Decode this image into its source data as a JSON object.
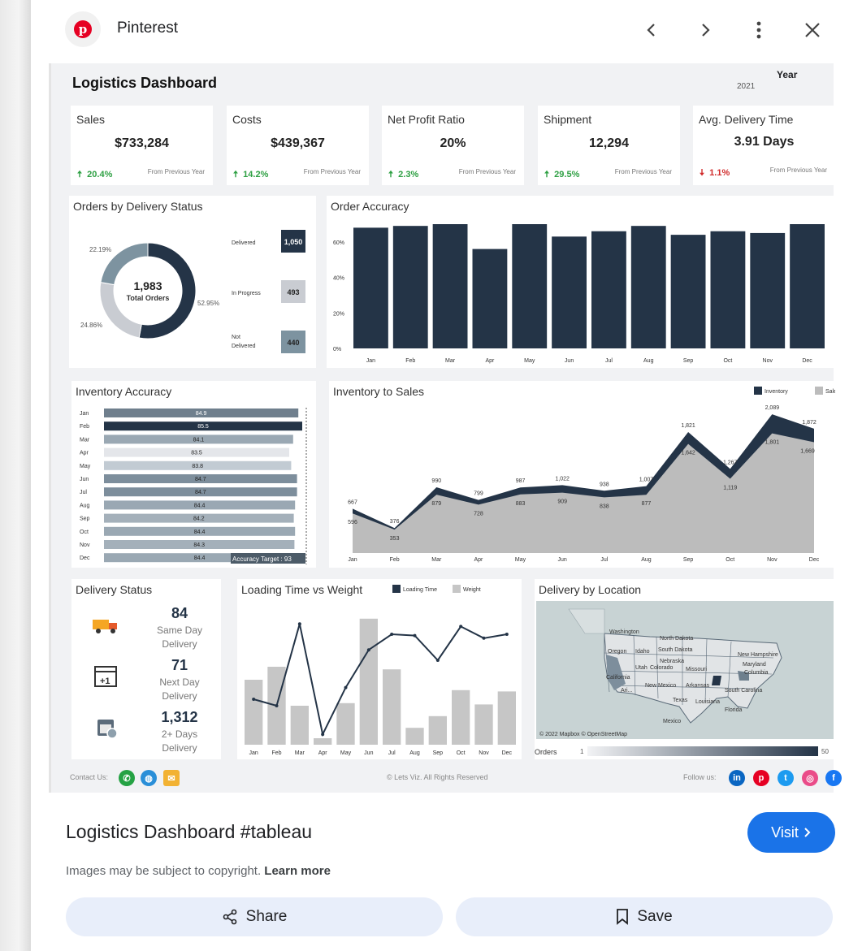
{
  "header": {
    "site_name": "Pinterest",
    "logo_letter": "p"
  },
  "dashboard": {
    "title": "Logistics Dashboard",
    "year_label": "Year",
    "year_value": "2021",
    "kpis": [
      {
        "title": "Sales",
        "value": "$733,284",
        "change": "20.4%",
        "direction": "up",
        "from": "From Previous Year"
      },
      {
        "title": "Costs",
        "value": "$439,367",
        "change": "14.2%",
        "direction": "up",
        "from": "From Previous Year"
      },
      {
        "title": "Net Profit Ratio",
        "value": "20%",
        "change": "2.3%",
        "direction": "up",
        "from": "From Previous Year"
      },
      {
        "title": "Shipment",
        "value": "12,294",
        "change": "29.5%",
        "direction": "up",
        "from": "From Previous Year"
      },
      {
        "title": "Avg. Delivery Time",
        "value": "3.91 Days",
        "change": "1.1%",
        "direction": "down",
        "from": "From Previous Year"
      }
    ],
    "delivery_status_section": {
      "title": "Delivery Status",
      "items": [
        {
          "value": "84",
          "label1": "Same Day",
          "label2": "Delivery"
        },
        {
          "value": "71",
          "label1": "Next Day",
          "label2": "Delivery"
        },
        {
          "value": "1,312",
          "label1": "2+ Days",
          "label2": "Delivery"
        }
      ]
    },
    "map": {
      "title": "Delivery by Location",
      "credit": "© 2022 Mapbox © OpenStreetMap",
      "legend_label": "Orders",
      "legend_min": "1",
      "legend_max": "50",
      "state_labels": [
        "Washington",
        "North Dakota",
        "South Dakota",
        "Oregon",
        "Idaho",
        "Nebraska",
        "Utah",
        "Colorado",
        "California",
        "Missouri",
        "New Mexico",
        "Arkansas",
        "Texas",
        "Louisiana",
        "Florida",
        "South Carolina",
        "New Hampshire",
        "Maryland",
        "Columbia",
        "Mexico",
        "Ari..."
      ]
    },
    "footer": {
      "contact": "Contact Us:",
      "copyright": "© Lets Viz. All Rights Reserved",
      "follow": "Follow us:"
    }
  },
  "chart_data": [
    {
      "type": "pie",
      "title": "Orders by Delivery Status",
      "center_value": "1,983",
      "center_label": "Total Orders",
      "slices": [
        {
          "label": "Delivered",
          "value": 1050,
          "percent": "52.95%"
        },
        {
          "label": "In Progress",
          "value": 493,
          "percent": "24.86%"
        },
        {
          "label": "Not Delivered",
          "value": 440,
          "percent": "22.19%"
        }
      ],
      "colors": [
        "#243447",
        "#c9ccd2",
        "#7d93a0"
      ],
      "value_labels": [
        "1,050",
        "493",
        "440"
      ],
      "legend_labels": [
        "Delivered",
        "In Progress",
        "Not",
        "Delivered"
      ]
    },
    {
      "type": "bar",
      "title": "Order Accuracy",
      "categories": [
        "Jan",
        "Feb",
        "Mar",
        "Apr",
        "May",
        "Jun",
        "Jul",
        "Aug",
        "Sep",
        "Oct",
        "Nov",
        "Dec"
      ],
      "values": [
        68,
        69,
        70,
        56,
        70,
        63,
        66,
        69,
        64,
        66,
        65,
        70
      ],
      "ylim": [
        0,
        70
      ],
      "yticks": [
        "0%",
        "20%",
        "40%",
        "60%"
      ],
      "ytick_values": [
        0,
        20,
        40,
        60
      ],
      "color": "#243447"
    },
    {
      "type": "bar",
      "title": "Inventory Accuracy",
      "orientation": "horizontal",
      "categories": [
        "Jan",
        "Feb",
        "Mar",
        "Apr",
        "May",
        "Jun",
        "Jul",
        "Aug",
        "Sep",
        "Oct",
        "Nov",
        "Dec"
      ],
      "values": [
        84.9,
        85.5,
        84.1,
        83.5,
        83.8,
        84.7,
        84.7,
        84.4,
        84.2,
        84.4,
        84.3,
        84.4
      ],
      "value_labels": [
        "84.9",
        "85.5",
        "84.1",
        "83.5",
        "83.8",
        "84.7",
        "84.7",
        "84.4",
        "84.2",
        "84.4",
        "84.3",
        "84.4"
      ],
      "target_label": "Accuracy Target : 93",
      "target": 93
    },
    {
      "type": "area",
      "title": "Inventory to Sales",
      "categories": [
        "Jan",
        "Feb",
        "Mar",
        "Apr",
        "May",
        "Jun",
        "Jul",
        "Aug",
        "Sep",
        "Oct",
        "Nov",
        "Dec"
      ],
      "series": [
        {
          "name": "Inventory",
          "values": [
            667,
            376,
            990,
            799,
            987,
            1022,
            938,
            1007,
            1821,
            1267,
            2089,
            1872
          ],
          "labels": [
            "667",
            "376",
            "990",
            "799",
            "987",
            "1,022",
            "938",
            "1,007",
            "1,821",
            "1,267",
            "2,089",
            "1,872"
          ],
          "color": "#243447"
        },
        {
          "name": "Sales",
          "values": [
            596,
            353,
            879,
            728,
            883,
            909,
            838,
            877,
            1642,
            1119,
            1801,
            1669
          ],
          "labels": [
            "596",
            "353",
            "879",
            "728",
            "883",
            "909",
            "838",
            "877",
            "1,642",
            "1,119",
            "1,801",
            "1,669"
          ],
          "color": "#bcbcbc"
        }
      ],
      "ylim": [
        0,
        2200
      ]
    },
    {
      "type": "bar",
      "title": "Loading Time vs Weight",
      "categories": [
        "Jan",
        "Feb",
        "Mar",
        "Apr",
        "May",
        "Jun",
        "Jul",
        "Aug",
        "Sep",
        "Oct",
        "Nov",
        "Dec"
      ],
      "series": [
        {
          "name": "Loading Time",
          "type": "line",
          "values": [
            35,
            30,
            93,
            8,
            44,
            73,
            85,
            84,
            65,
            91,
            82,
            85
          ],
          "color": "#243447"
        },
        {
          "name": "Weight",
          "type": "bar",
          "values": [
            50,
            60,
            30,
            5,
            32,
            97,
            58,
            13,
            22,
            42,
            31,
            41
          ],
          "color": "#c6c6c6"
        }
      ],
      "ylim": [
        0,
        100
      ]
    }
  ],
  "pin": {
    "title": "Logistics Dashboard #tableau",
    "visit_label": "Visit",
    "copyright_text": "Images may be subject to copyright.",
    "learn_more": "Learn more"
  },
  "actions": {
    "share_label": "Share",
    "save_label": "Save"
  }
}
